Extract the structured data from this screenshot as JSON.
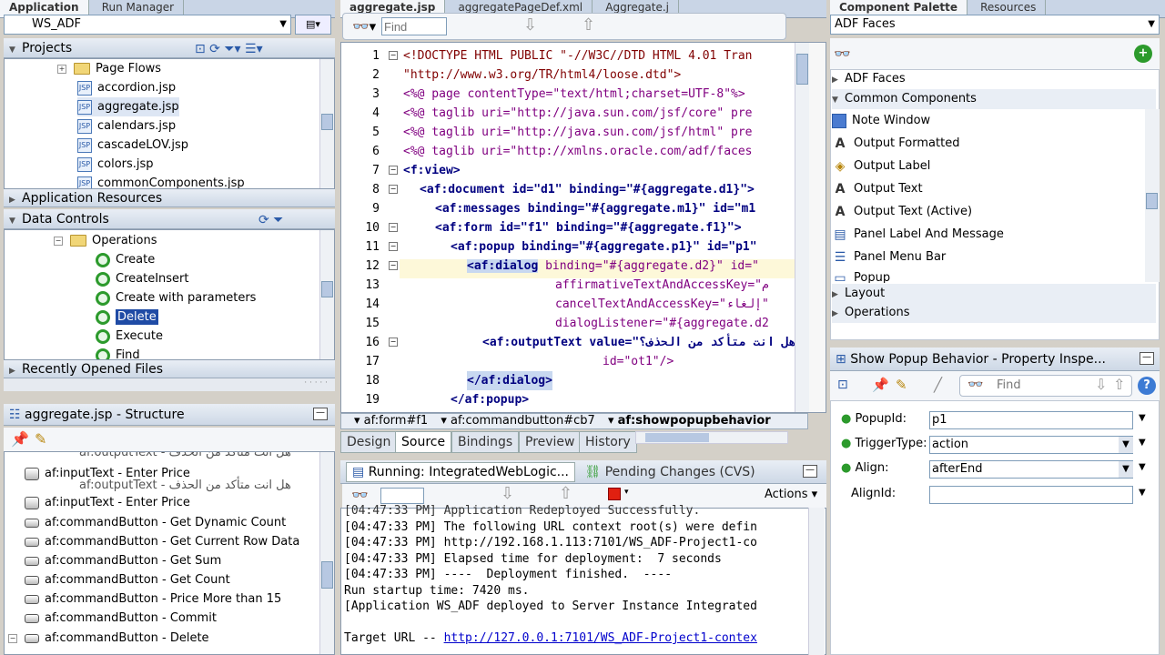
{
  "top_tabs": {
    "left": [
      "Application",
      "Run Manager"
    ],
    "editor": [
      "aggregate.jsp",
      "aggregatePageDef.xml",
      "Aggregate.j"
    ],
    "right": [
      "Component Palette",
      "Resources"
    ]
  },
  "app_selector": "WS_ADF",
  "projects": {
    "title": "Projects",
    "items": [
      "Page Flows",
      "accordion.jsp",
      "aggregate.jsp",
      "calendars.jsp",
      "cascadeLOV.jsp",
      "colors.jsp",
      "commonComponents.jsp"
    ]
  },
  "app_resources": "Application Resources",
  "data_controls": {
    "title": "Data Controls",
    "folder": "Operations",
    "items": [
      "Create",
      "CreateInsert",
      "Create with parameters",
      "Delete",
      "Execute",
      "Find"
    ]
  },
  "recent_files": "Recently Opened Files",
  "structure": {
    "title": "aggregate.jsp - Structure",
    "items": [
      "af:inputText - Enter Price",
      "af:inputText - Enter Price",
      "af:commandButton - Get Dynamic Count",
      "af:commandButton - Get Current Row Data",
      "af:commandButton - Get Sum",
      "af:commandButton - Get Count",
      "af:commandButton - Price More than 15",
      "af:commandButton - Commit",
      "af:commandButton - Delete"
    ],
    "cut_a": "af:outputText - هل انت متأكد من الحذف",
    "cut_b": "af:outputText - هل انت متأكد من الحذف"
  },
  "editor": {
    "find_placeholder": "Find",
    "lines": [
      "1",
      "2",
      "3",
      "4",
      "5",
      "6",
      "7",
      "8",
      "9",
      "10",
      "11",
      "12",
      "13",
      "14",
      "15",
      "16",
      "17",
      "18",
      "19"
    ],
    "c1": "<!DOCTYPE HTML PUBLIC \"-//W3C//DTD HTML 4.01 Tran",
    "c2": "\"http://www.w3.org/TR/html4/loose.dtd\">",
    "c3": "<%@ page contentType=\"text/html;charset=UTF-8\"%>",
    "c4": "<%@ taglib uri=\"http://java.sun.com/jsf/core\" pre",
    "c5": "<%@ taglib uri=\"http://java.sun.com/jsf/html\" pre",
    "c6": "<%@ taglib uri=\"http://xmlns.oracle.com/adf/faces",
    "c7": "<f:view>",
    "c8": "<af:document id=\"d1\" binding=\"#{aggregate.d1}\">",
    "c9": "<af:messages binding=\"#{aggregate.m1}\" id=\"m1",
    "c10": "<af:form id=\"f1\" binding=\"#{aggregate.f1}\">",
    "c11": "<af:popup binding=\"#{aggregate.p1}\" id=\"p1\"",
    "c12tag": "<af:dialog",
    "c12rest": " binding=\"#{aggregate.d2}\" id=\"",
    "c13": "affirmativeTextAndAccessKey=\"م",
    "c14": "cancelTextAndAccessKey=\"إلغاء\"",
    "c15": "dialogListener=\"#{aggregate.d2",
    "c16": "<af:outputText value=\"هل انت متأكد من الحذف؟",
    "c17": "id=\"ot1\"/>",
    "c18": "</af:dialog>",
    "c19": "</af:popup>"
  },
  "breadcrumb": [
    "af:form#f1",
    "af:commandbutton#cb7",
    "af:showpopupbehavior"
  ],
  "editor_tabs": [
    "Design",
    "Source",
    "Bindings",
    "Preview",
    "History"
  ],
  "log": {
    "tabs": [
      "Running: IntegratedWebLogic...",
      "Pending Changes (CVS)"
    ],
    "actions": "Actions",
    "lines": [
      "[04:47:33 PM] Application Redeployed Successfully.",
      "[04:47:33 PM] The following URL context root(s) were defin",
      "[04:47:33 PM] http://192.168.1.113:7101/WS_ADF-Project1-co",
      "[04:47:33 PM] Elapsed time for deployment:  7 seconds",
      "[04:47:33 PM] ----  Deployment finished.  ----",
      "Run startup time: 7420 ms.",
      "[Application WS_ADF deployed to Server Instance Integrated",
      ""
    ],
    "target_label": "Target URL -- ",
    "target_url": "http://127.0.0.1:7101/WS_ADF-Project1-contex"
  },
  "palette": {
    "selector": "ADF Faces",
    "sections": [
      "ADF Faces",
      "Common Components",
      "Layout",
      "Operations"
    ],
    "items": [
      "Note Window",
      "Output Formatted",
      "Output Label",
      "Output Text",
      "Output Text (Active)",
      "Panel Label And Message",
      "Panel Menu Bar",
      "Popup"
    ]
  },
  "inspector": {
    "title": "Show Popup Behavior - Property Inspe...",
    "find": "Find",
    "props": [
      {
        "label": "PopupId:",
        "value": "p1"
      },
      {
        "label": "TriggerType:",
        "value": "action"
      },
      {
        "label": "Align:",
        "value": "afterEnd"
      },
      {
        "label": "AlignId:",
        "value": ""
      }
    ]
  },
  "colors": {
    "selection": "#1f4ba5",
    "panel_header": "#cdd8e6",
    "link": "#0000cc"
  }
}
